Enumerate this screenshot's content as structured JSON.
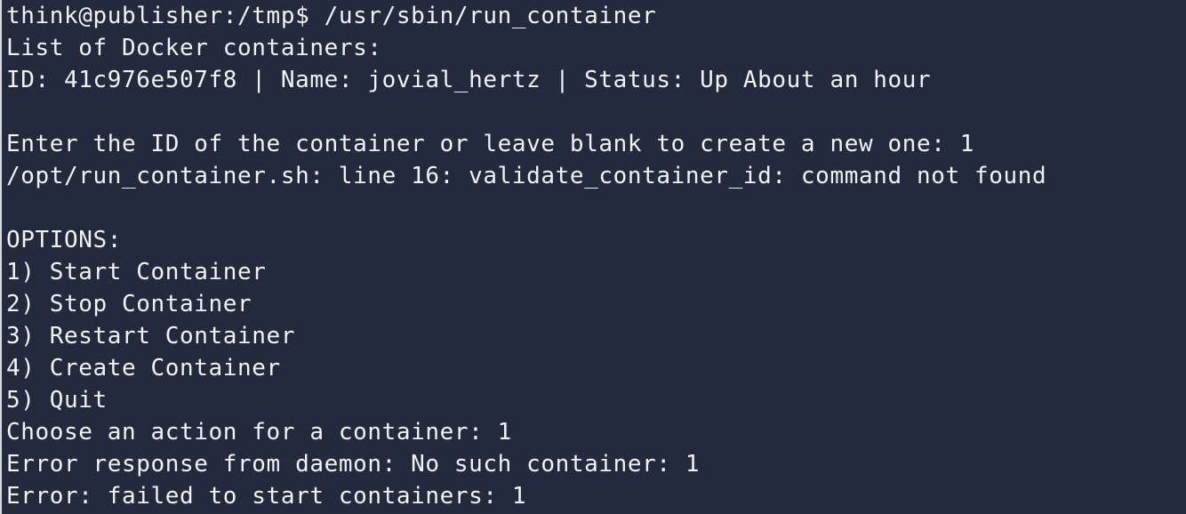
{
  "terminal": {
    "lines": [
      "think@publisher:/tmp$ /usr/sbin/run_container",
      "List of Docker containers:",
      "ID: 41c976e507f8 | Name: jovial_hertz | Status: Up About an hour",
      "",
      "Enter the ID of the container or leave blank to create a new one: 1",
      "/opt/run_container.sh: line 16: validate_container_id: command not found",
      "",
      "OPTIONS:",
      "1) Start Container",
      "2) Stop Container",
      "3) Restart Container",
      "4) Create Container",
      "5) Quit",
      "Choose an action for a container: 1",
      "Error response from daemon: No such container: 1",
      "Error: failed to start containers: 1"
    ]
  },
  "colors": {
    "background": "#232a3d",
    "foreground": "#f2f2f2",
    "border": "#d7d9de"
  }
}
